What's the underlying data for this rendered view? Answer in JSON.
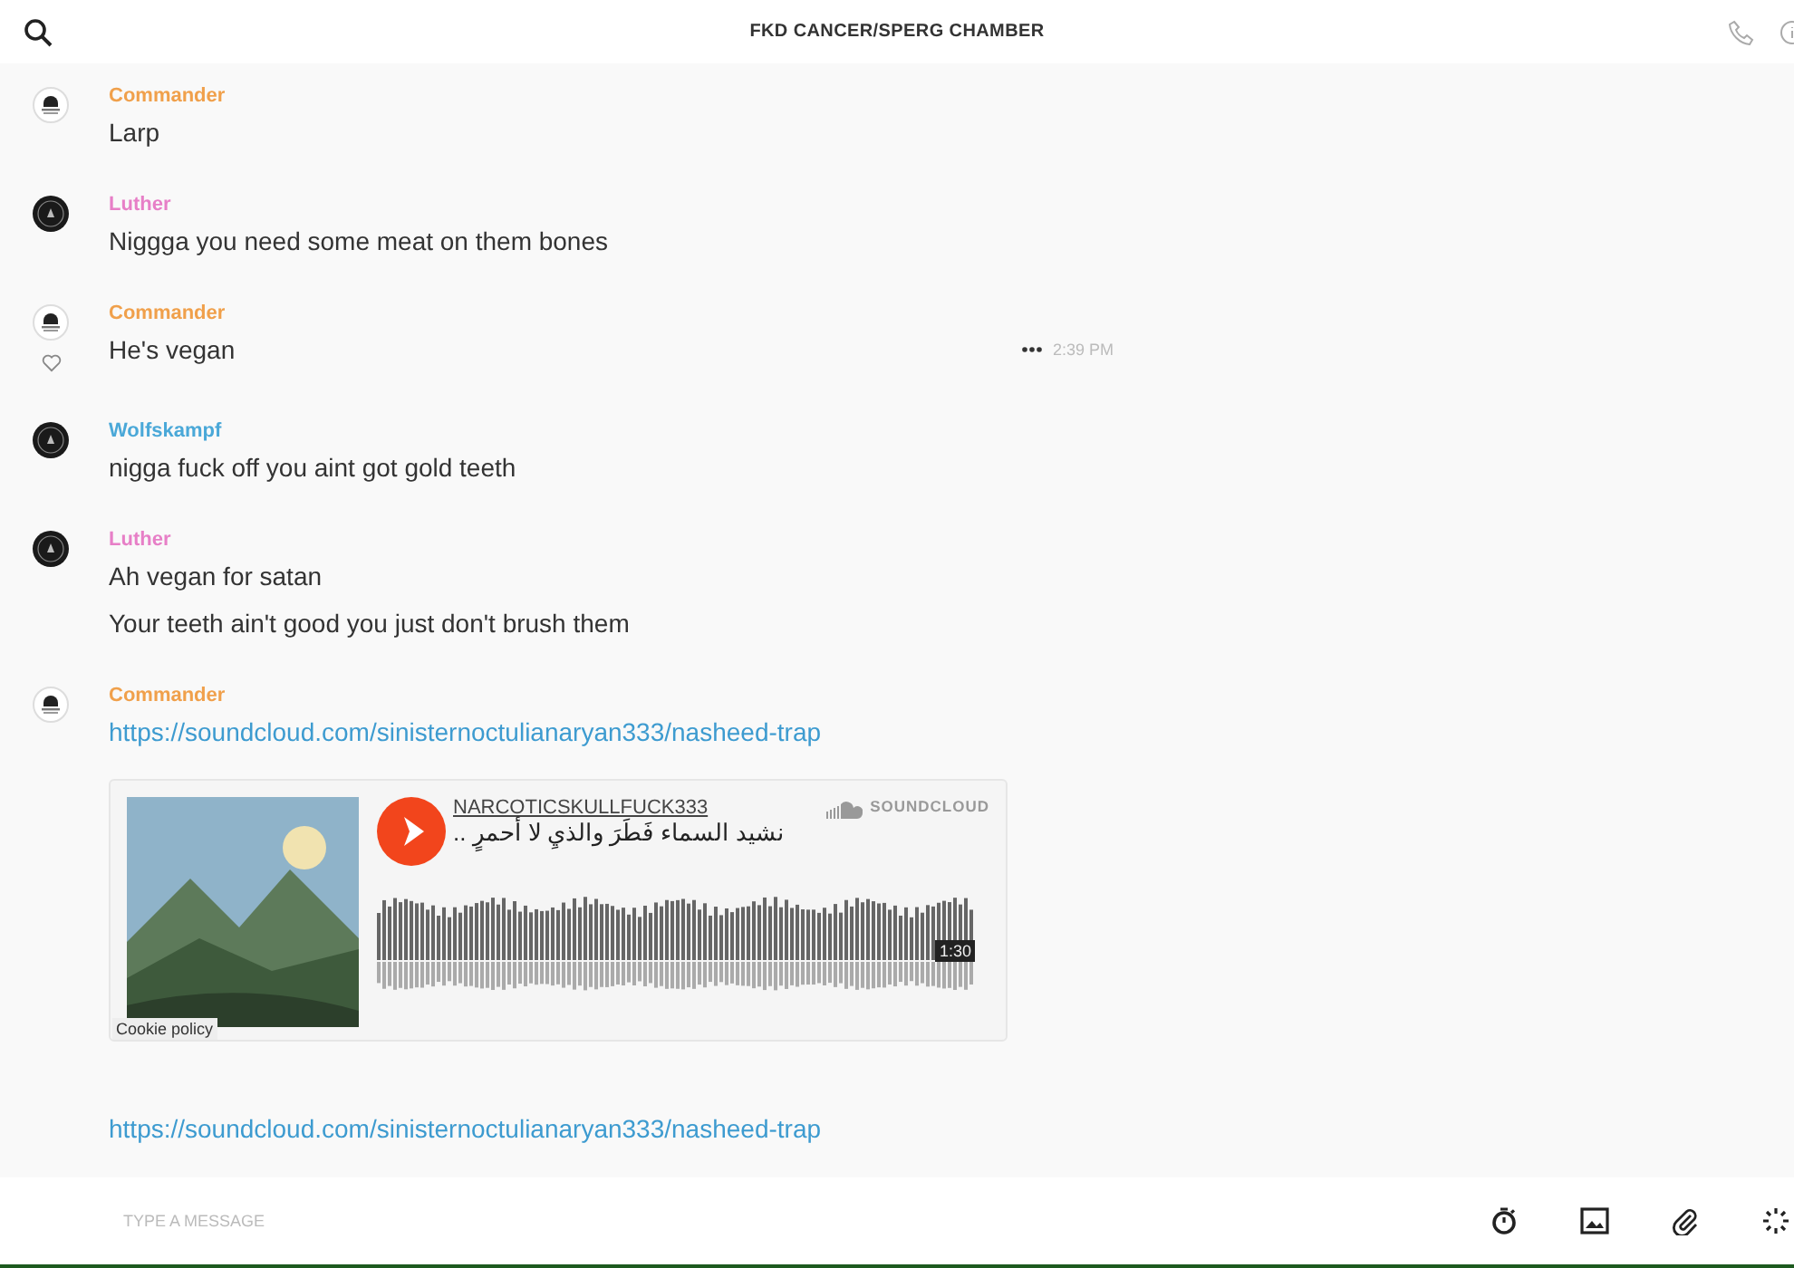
{
  "header": {
    "title": "FKD CANCER/SPERG CHAMBER"
  },
  "messages": [
    {
      "author": "Commander",
      "color": "#f0a04b",
      "kind": "light",
      "hovered": false,
      "parts": [
        {
          "kind": "text",
          "text": "Larp"
        }
      ]
    },
    {
      "author": "Luther",
      "color": "#e77fc7",
      "kind": "dark",
      "hovered": false,
      "parts": [
        {
          "kind": "text",
          "text": "Niggga you need some meat on them bones"
        }
      ]
    },
    {
      "author": "Commander",
      "color": "#f0a04b",
      "kind": "light",
      "hovered": true,
      "time": "2:39 PM",
      "parts": [
        {
          "kind": "text",
          "text": "He's vegan"
        }
      ]
    },
    {
      "author": "Wolfskampf",
      "color": "#4aa8d8",
      "kind": "dark",
      "hovered": false,
      "parts": [
        {
          "kind": "text",
          "text": "nigga fuck off you aint got gold teeth"
        }
      ]
    },
    {
      "author": "Luther",
      "color": "#e77fc7",
      "kind": "dark",
      "hovered": false,
      "parts": [
        {
          "kind": "text",
          "text": "Ah vegan for satan"
        },
        {
          "kind": "text",
          "text": "Your teeth ain't good you just don't brush them"
        }
      ]
    },
    {
      "author": "Commander",
      "color": "#f0a04b",
      "kind": "light",
      "hovered": false,
      "parts": [
        {
          "kind": "link",
          "text": "https://soundcloud.com/sinisternoctulianaryan333/nasheed-trap"
        },
        {
          "kind": "embed",
          "user": "NARCOTICSKULLFUCK333",
          "title": "نشيد السماء فَطَرَ والذيِ لا أحمرٍ ..",
          "brand": "SOUNDCLOUD",
          "duration": "1:30",
          "cookie": "Cookie policy"
        },
        {
          "kind": "link",
          "text": "https://soundcloud.com/sinisternoctulianaryan333/nasheed-trap"
        }
      ]
    }
  ],
  "composer": {
    "placeholder": "TYPE A MESSAGE"
  }
}
